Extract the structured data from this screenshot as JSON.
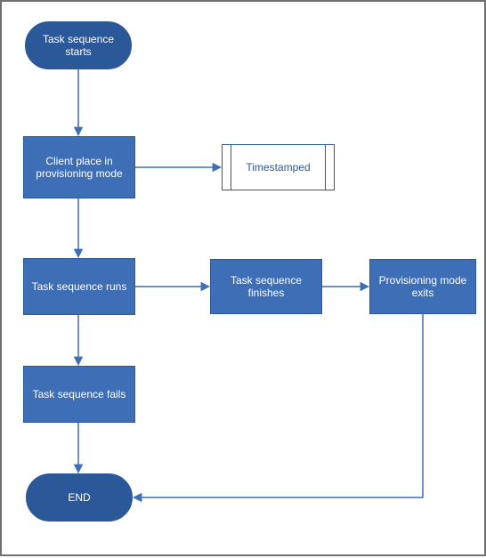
{
  "chart_data": {
    "type": "flowchart",
    "title": "",
    "nodes": [
      {
        "id": "start",
        "shape": "terminator",
        "label": "Task sequence starts"
      },
      {
        "id": "provision",
        "shape": "process",
        "label": "Client place in provisioning mode"
      },
      {
        "id": "timestamped",
        "shape": "predefined",
        "label": "Timestamped"
      },
      {
        "id": "runs",
        "shape": "process",
        "label": "Task sequence runs"
      },
      {
        "id": "finishes",
        "shape": "process",
        "label": "Task sequence finishes"
      },
      {
        "id": "exits",
        "shape": "process",
        "label": "Provisioning mode exits"
      },
      {
        "id": "fails",
        "shape": "process",
        "label": "Task sequence fails"
      },
      {
        "id": "end",
        "shape": "terminator",
        "label": "END"
      }
    ],
    "edges": [
      {
        "from": "start",
        "to": "provision"
      },
      {
        "from": "provision",
        "to": "timestamped"
      },
      {
        "from": "provision",
        "to": "runs"
      },
      {
        "from": "runs",
        "to": "finishes"
      },
      {
        "from": "finishes",
        "to": "exits"
      },
      {
        "from": "runs",
        "to": "fails"
      },
      {
        "from": "fails",
        "to": "end"
      },
      {
        "from": "exits",
        "to": "end"
      }
    ]
  },
  "colors": {
    "node_fill": "#3e6eb5",
    "node_border": "#2b5899",
    "terminator_fill": "#2b5899",
    "arrow": "#3e6eb5"
  }
}
